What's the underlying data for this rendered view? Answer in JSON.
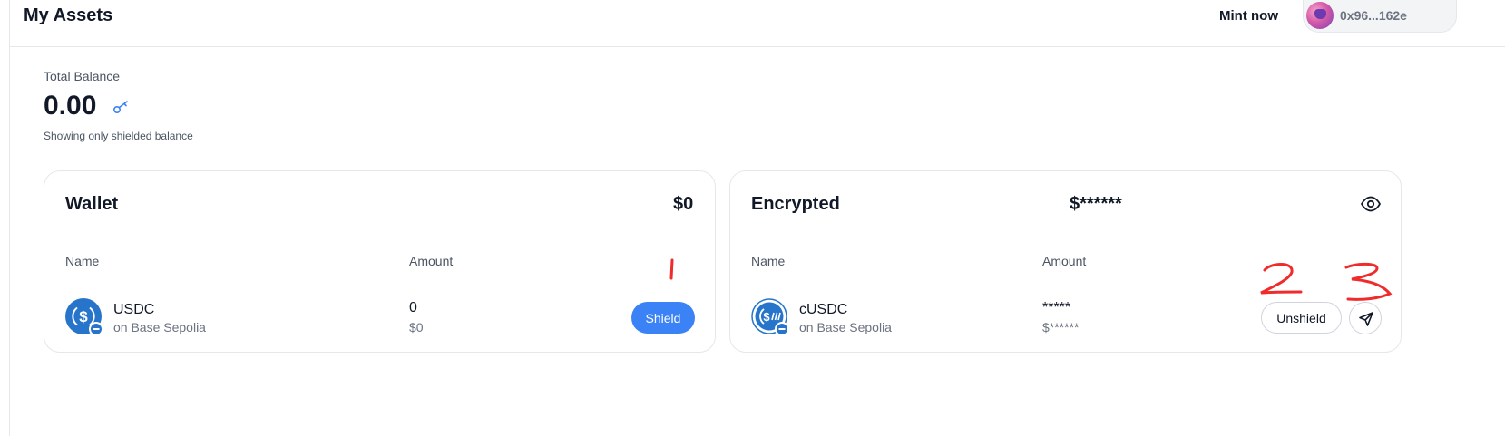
{
  "header": {
    "title": "My Assets",
    "mint_label": "Mint now",
    "wallet_address": "0x96...162e"
  },
  "balance": {
    "label": "Total Balance",
    "value": "0.00",
    "note": "Showing only shielded balance"
  },
  "wallet_card": {
    "title": "Wallet",
    "total": "$0",
    "columns": {
      "name": "Name",
      "amount": "Amount"
    },
    "token": {
      "name": "USDC",
      "chain": "on Base Sepolia",
      "amount": "0",
      "usd": "$0"
    },
    "shield_label": "Shield"
  },
  "encrypted_card": {
    "title": "Encrypted",
    "total": "$******",
    "columns": {
      "name": "Name",
      "amount": "Amount"
    },
    "token": {
      "name": "cUSDC",
      "chain": "on Base Sepolia",
      "amount": "*****",
      "usd": "$******"
    },
    "unshield_label": "Unshield"
  },
  "annotations": {
    "marker_1": "1",
    "marker_2": "2",
    "marker_3": "3",
    "color": "#ef2b2b"
  },
  "colors": {
    "accent": "#3b82f6",
    "usdc_blue": "#2775ca",
    "border": "#e5e7eb"
  },
  "icons": [
    "key-icon",
    "eye-icon",
    "send-icon",
    "usdc-logo-icon",
    "cusdc-logo-icon"
  ]
}
